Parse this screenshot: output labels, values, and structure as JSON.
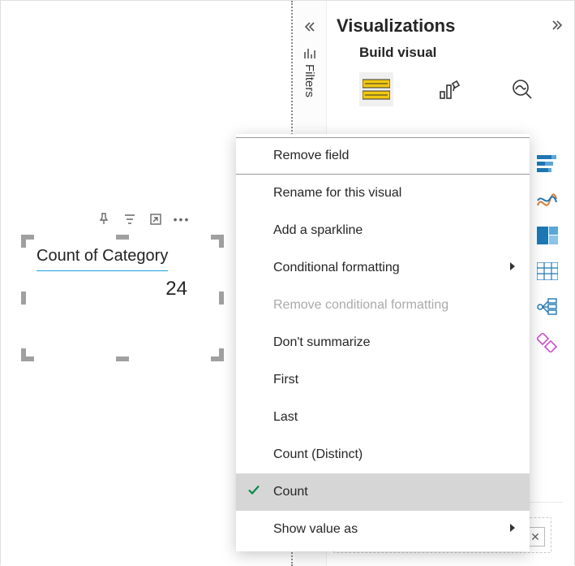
{
  "canvas": {
    "toolbar_icons": [
      "pin-icon",
      "filter-icon",
      "focus-mode-icon",
      "more-icon"
    ],
    "card": {
      "title": "Count of Category",
      "value": "24"
    }
  },
  "filters": {
    "label": "Filters"
  },
  "viz": {
    "title": "Visualizations",
    "subtitle": "Build visual",
    "tabs": [
      "build-visual",
      "format-visual",
      "analytics"
    ],
    "gallery": [
      "stacked-bar-icon",
      "ribbon-icon",
      "treemap-icon",
      "matrix-icon",
      "decomposition-icon",
      "model-icon"
    ]
  },
  "menu": {
    "items": [
      {
        "label": "Remove field",
        "submenu": false,
        "disabled": false,
        "checked": false,
        "highlight": true
      },
      {
        "label": "Rename for this visual",
        "submenu": false,
        "disabled": false,
        "checked": false
      },
      {
        "label": "Add a sparkline",
        "submenu": false,
        "disabled": false,
        "checked": false
      },
      {
        "label": "Conditional formatting",
        "submenu": true,
        "disabled": false,
        "checked": false
      },
      {
        "label": "Remove conditional formatting",
        "submenu": false,
        "disabled": true,
        "checked": false
      },
      {
        "label": "Don't summarize",
        "submenu": false,
        "disabled": false,
        "checked": false
      },
      {
        "label": "First",
        "submenu": false,
        "disabled": false,
        "checked": false
      },
      {
        "label": "Last",
        "submenu": false,
        "disabled": false,
        "checked": false
      },
      {
        "label": "Count (Distinct)",
        "submenu": false,
        "disabled": false,
        "checked": false
      },
      {
        "label": "Count",
        "submenu": false,
        "disabled": false,
        "checked": true
      },
      {
        "label": "Show value as",
        "submenu": true,
        "disabled": false,
        "checked": false
      }
    ]
  }
}
